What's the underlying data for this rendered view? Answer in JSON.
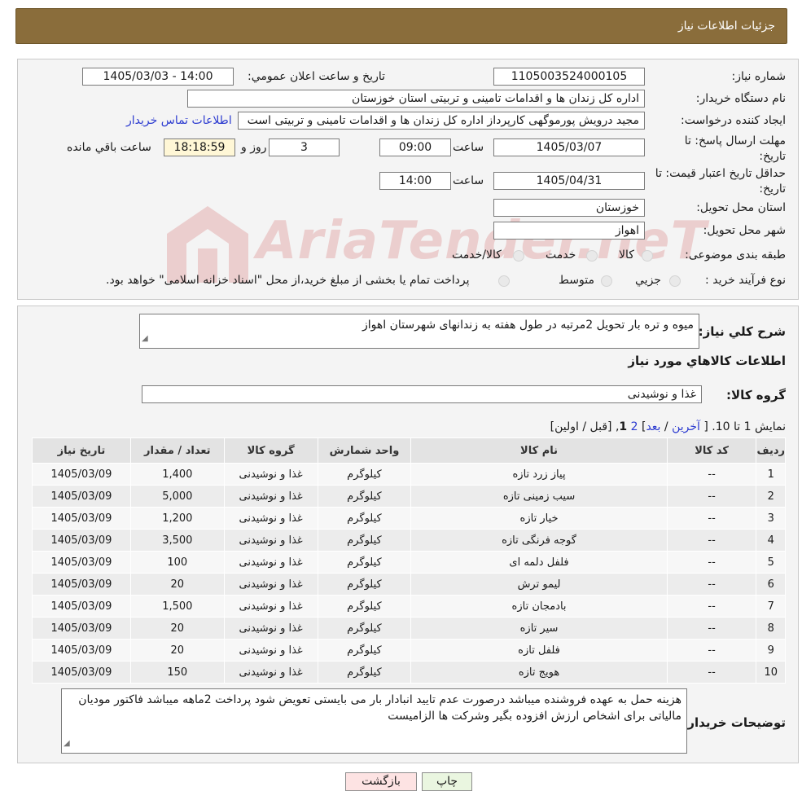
{
  "header": {
    "title": "جزئیات اطلاعات نیاز"
  },
  "form": {
    "need_number_label": "شماره نیاز:",
    "need_number": "1105003524000105",
    "announce_label": "تاریخ و ساعت اعلان عمومي:",
    "announce_value": "1405/03/03 - 14:00",
    "buyer_org_label": "نام دستگاه خريدار:",
    "buyer_org": "اداره کل زندان ها و اقدامات تامینی و تربیتی استان خوزستان",
    "creator_label": "ايجاد کننده درخواست:",
    "creator": "مجید درویش پورموگهی کارپرداز اداره کل زندان ها و اقدامات تامینی و تربیتی است",
    "contact_link": "اطلاعات تماس خريدار",
    "deadline_label_1": "مهلت ارسال پاسخ: تا",
    "deadline_label_2": "تاريخ:",
    "deadline_date": "1405/03/07",
    "time_label": "ساعت",
    "deadline_time": "09:00",
    "days_value": "3",
    "days_label": "روز و",
    "remaining_time": "18:18:59",
    "remaining_label": "ساعت باقي مانده",
    "validity_label_1": "حداقل تاريخ اعتبار قيمت: تا",
    "validity_label_2": "تاريخ:",
    "validity_date": "1405/04/31",
    "validity_time": "14:00",
    "province_label": "استان محل تحويل:",
    "province": "خوزستان",
    "city_label": "شهر محل تحويل:",
    "city": "اهواز",
    "category_label": "طبقه بندی موضوعی:",
    "category_options": [
      "کالا",
      "خدمت",
      "کالا/خدمت"
    ],
    "process_label": "نوع فرآيند خريد :",
    "process_options": [
      "جزيي",
      "متوسط"
    ],
    "process_note": "پرداخت تمام يا بخشی از مبلغ خريد،از محل \"اسناد خزانه اسلامی\" خواهد بود."
  },
  "watermark": {
    "text": "AriaTender.neT"
  },
  "summary": {
    "label": "شرح کلي نياز:",
    "text": "میوه و تره بار تحویل 2مرتبه در طول هفته به زندانهای شهرستان اهواز"
  },
  "goods": {
    "section_title": "اطلاعات کالاهاي مورد نياز",
    "group_label": "گروه کالا:",
    "group_value": "غذا و نوشیدنی"
  },
  "pagination": {
    "prefix": "نمایش 1 تا 10. [",
    "last": "آخرین",
    "sep1": "/",
    "next": "بعد",
    "sep2": "]",
    "page2": "2",
    "page1": "1",
    "comma": ",",
    "rest": "[قبل / اولین]"
  },
  "table": {
    "headers": [
      "رديف",
      "کد کالا",
      "نام کالا",
      "واحد شمارش",
      "گروه کالا",
      "تعداد / مقدار",
      "تاريخ نياز"
    ],
    "rows": [
      [
        "1",
        "--",
        "پیاز زرد تازه",
        "کیلوگرم",
        "غذا و نوشیدنی",
        "1,400",
        "1405/03/09"
      ],
      [
        "2",
        "--",
        "سیب زمینی تازه",
        "کیلوگرم",
        "غذا و نوشیدنی",
        "5,000",
        "1405/03/09"
      ],
      [
        "3",
        "--",
        "خیار تازه",
        "کیلوگرم",
        "غذا و نوشیدنی",
        "1,200",
        "1405/03/09"
      ],
      [
        "4",
        "--",
        "گوجه فرنگی تازه",
        "کیلوگرم",
        "غذا و نوشیدنی",
        "3,500",
        "1405/03/09"
      ],
      [
        "5",
        "--",
        "فلفل دلمه ای",
        "کیلوگرم",
        "غذا و نوشیدنی",
        "100",
        "1405/03/09"
      ],
      [
        "6",
        "--",
        "لیمو ترش",
        "کیلوگرم",
        "غذا و نوشیدنی",
        "20",
        "1405/03/09"
      ],
      [
        "7",
        "--",
        "بادمجان تازه",
        "کیلوگرم",
        "غذا و نوشیدنی",
        "1,500",
        "1405/03/09"
      ],
      [
        "8",
        "--",
        "سیر تازه",
        "کیلوگرم",
        "غذا و نوشیدنی",
        "20",
        "1405/03/09"
      ],
      [
        "9",
        "--",
        "فلفل تازه",
        "کیلوگرم",
        "غذا و نوشیدنی",
        "20",
        "1405/03/09"
      ],
      [
        "10",
        "--",
        "هویج تازه",
        "کیلوگرم",
        "غذا و نوشیدنی",
        "150",
        "1405/03/09"
      ]
    ]
  },
  "buyer_notes": {
    "label": "توضيحات خريدار:",
    "text": "هزینه حمل به عهده فروشنده میباشد درصورت عدم تایید انبادار بار می بایستی تعویض شود پرداخت 2ماهه میباشد فاکتور مودیان مالیاتی برای اشخاص ارزش افزوده بگیر وشرکت ها الزامیست"
  },
  "buttons": {
    "print": "چاپ",
    "back": "بازگشت"
  },
  "colors": {
    "header_bg": "#8a6d3b",
    "link": "#2c3bd0",
    "back_button_bg": "#fde3e3",
    "print_button_bg": "#eaf6e0"
  }
}
